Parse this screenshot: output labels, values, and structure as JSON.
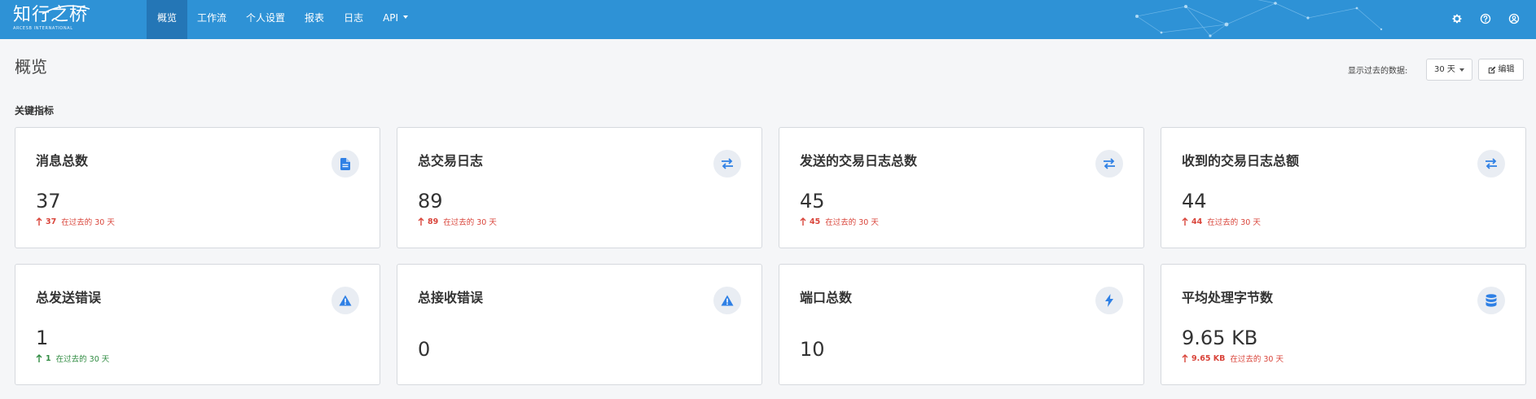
{
  "app": {
    "brand_name": "知行之桥",
    "brand_sub": "ARCESB INTERNATIONAL"
  },
  "nav": {
    "items": [
      {
        "label": "概览",
        "active": true
      },
      {
        "label": "工作流"
      },
      {
        "label": "个人设置"
      },
      {
        "label": "报表"
      },
      {
        "label": "日志"
      },
      {
        "label": "API",
        "has_dropdown": true
      }
    ],
    "right_icons": [
      "gear-icon",
      "help-icon",
      "user-icon"
    ]
  },
  "header": {
    "title": "概览",
    "range_label": "显示过去的数据:",
    "range_value": "30 天",
    "edit_label": "编辑"
  },
  "section": {
    "title": "关键指标"
  },
  "cards": [
    {
      "title": "消息总数",
      "value": "37",
      "icon": "document-icon",
      "trend": {
        "direction": "up",
        "value": "37",
        "text": "在过去的 30 天",
        "color": "#d9443a"
      }
    },
    {
      "title": "总交易日志",
      "value": "89",
      "icon": "exchange-icon",
      "trend": {
        "direction": "up",
        "value": "89",
        "text": "在过去的 30 天",
        "color": "#d9443a"
      }
    },
    {
      "title": "发送的交易日志总数",
      "value": "45",
      "icon": "exchange-icon",
      "trend": {
        "direction": "up",
        "value": "45",
        "text": "在过去的 30 天",
        "color": "#d9443a"
      }
    },
    {
      "title": "收到的交易日志总额",
      "value": "44",
      "icon": "exchange-icon",
      "trend": {
        "direction": "up",
        "value": "44",
        "text": "在过去的 30 天",
        "color": "#d9443a"
      }
    },
    {
      "title": "总发送错误",
      "value": "1",
      "icon": "warning-icon",
      "trend": {
        "direction": "up",
        "value": "1",
        "text": "在过去的 30 天",
        "color": "#2f8b41"
      }
    },
    {
      "title": "总接收错误",
      "value": "0",
      "icon": "warning-icon"
    },
    {
      "title": "端口总数",
      "value": "10",
      "icon": "bolt-icon"
    },
    {
      "title": "平均处理字节数",
      "value": "9.65 KB",
      "icon": "database-icon",
      "trend": {
        "direction": "up",
        "value": "9.65 KB",
        "text": "在过去的 30 天",
        "color": "#d9443a"
      }
    }
  ],
  "colors": {
    "topbar": "#2e92d6",
    "nav_active": "#2476b6",
    "icon_accent": "#2f80e5",
    "trend_up_red": "#d9443a",
    "trend_up_green": "#2f8b41"
  }
}
